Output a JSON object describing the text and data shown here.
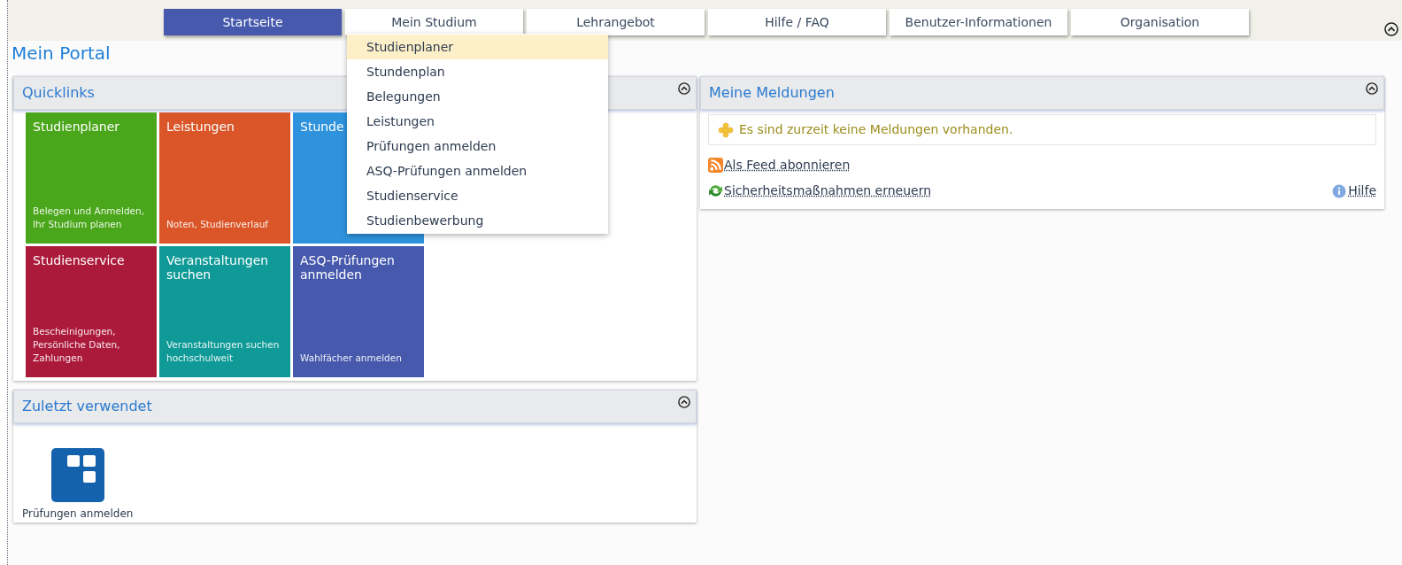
{
  "nav": {
    "tabs": [
      {
        "label": "Startseite",
        "selected": true
      },
      {
        "label": "Mein Studium",
        "selected": false
      },
      {
        "label": "Lehrangebot",
        "selected": false
      },
      {
        "label": "Hilfe / FAQ",
        "selected": false
      },
      {
        "label": "Benutzer-Informationen",
        "selected": false
      },
      {
        "label": "Organisation",
        "selected": false
      }
    ],
    "dropdown": {
      "items": [
        {
          "label": "Studienplaner",
          "highlighted": true
        },
        {
          "label": "Stundenplan",
          "highlighted": false
        },
        {
          "label": "Belegungen",
          "highlighted": false
        },
        {
          "label": "Leistungen",
          "highlighted": false
        },
        {
          "label": "Prüfungen anmelden",
          "highlighted": false
        },
        {
          "label": "ASQ-Prüfungen anmelden",
          "highlighted": false
        },
        {
          "label": "Studienservice",
          "highlighted": false
        },
        {
          "label": "Studienbewerbung",
          "highlighted": false
        }
      ]
    }
  },
  "page_title": "Mein Portal",
  "quicklinks": {
    "title": "Quicklinks",
    "tiles": [
      {
        "title": "Studienplaner",
        "subtitle": "Belegen und Anmelden, Ihr Studium planen",
        "color": "#4aa61a"
      },
      {
        "title": "Leistungen",
        "subtitle": "Noten, Studienverlauf",
        "color": "#da5629"
      },
      {
        "title": "Stunde",
        "color": "#2e93dc"
      },
      {
        "title": "Studienservice",
        "subtitle": "Bescheinigungen, Persönliche Daten, Zahlungen",
        "color": "#ab1a3b"
      },
      {
        "title": "Veranstaltungen suchen",
        "subtitle": "Veranstaltungen suchen hochschulweit",
        "color": "#0f9a97"
      },
      {
        "title": "ASQ-Prüfungen anmelden",
        "subtitle": "Wahlfächer anmelden",
        "color": "#4659ad"
      }
    ]
  },
  "recent": {
    "title": "Zuletzt verwendet",
    "items": [
      {
        "label": "Prüfungen anmelden"
      }
    ]
  },
  "messages": {
    "title": "Meine Meldungen",
    "notice": "Es sind zurzeit keine Meldungen vorhanden.",
    "links": [
      {
        "kind": "feed",
        "label": "Als Feed abonnieren"
      },
      {
        "kind": "refresh",
        "label": "Sicherheitsmaßnahmen erneuern"
      }
    ],
    "help": "Hilfe"
  }
}
